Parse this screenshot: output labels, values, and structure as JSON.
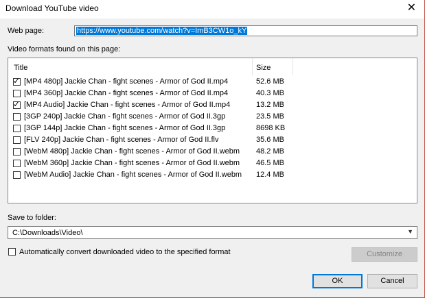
{
  "window": {
    "title": "Download YouTube video",
    "close_glyph": "✕"
  },
  "web_page": {
    "label": "Web page:",
    "value": "https://www.youtube.com/watch?v=ImB3CW1o_kY"
  },
  "formats": {
    "label": "Video formats found on this page:",
    "columns": [
      "Title",
      "Size"
    ],
    "rows": [
      {
        "checked": true,
        "title": "[MP4 480p] Jackie Chan - fight scenes - Armor of God II.mp4",
        "size": "52.6 MB"
      },
      {
        "checked": false,
        "title": "[MP4 360p] Jackie Chan - fight scenes - Armor of God II.mp4",
        "size": "40.3 MB"
      },
      {
        "checked": true,
        "title": "[MP4 Audio] Jackie Chan - fight scenes - Armor of God II.mp4",
        "size": "13.2 MB"
      },
      {
        "checked": false,
        "title": "[3GP 240p] Jackie Chan - fight scenes - Armor of God II.3gp",
        "size": "23.5 MB"
      },
      {
        "checked": false,
        "title": "[3GP 144p] Jackie Chan - fight scenes - Armor of God II.3gp",
        "size": "8698 KB"
      },
      {
        "checked": false,
        "title": "[FLV 240p] Jackie Chan - fight scenes - Armor of God II.flv",
        "size": "35.6 MB"
      },
      {
        "checked": false,
        "title": "[WebM 480p] Jackie Chan - fight scenes - Armor of God II.webm",
        "size": "48.2 MB"
      },
      {
        "checked": false,
        "title": "[WebM 360p] Jackie Chan - fight scenes - Armor of God II.webm",
        "size": "46.5 MB"
      },
      {
        "checked": false,
        "title": "[WebM Audio] Jackie Chan - fight scenes - Armor of God II.webm",
        "size": "12.4 MB"
      }
    ]
  },
  "save_folder": {
    "label": "Save to folder:",
    "value": "C:\\Downloads\\Video\\"
  },
  "auto_convert": {
    "checked": false,
    "label": "Automatically convert downloaded video to the specified format"
  },
  "buttons": {
    "customize": "Customize",
    "ok": "OK",
    "cancel": "Cancel"
  },
  "colors": {
    "accent": "#0078d7",
    "selection": "#0078d7",
    "window_border": "#c14a3e"
  }
}
